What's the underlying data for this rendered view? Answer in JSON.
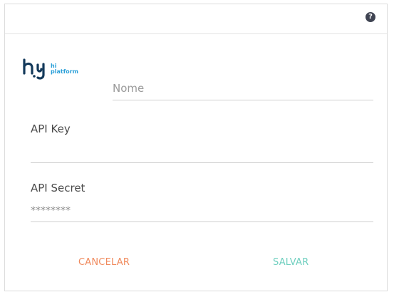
{
  "header": {
    "help_icon": "question-circle-icon",
    "help_glyph": "?"
  },
  "logo": {
    "text_hi": "hi",
    "text_platform": "platform",
    "colors": {
      "mark": "#13395a",
      "accent": "#2a9fd8"
    }
  },
  "form": {
    "name": {
      "placeholder": "Nome",
      "value": ""
    },
    "api_key": {
      "label": "API Key",
      "value": ""
    },
    "api_secret": {
      "label": "API Secret",
      "value": "********"
    }
  },
  "actions": {
    "cancel_label": "CANCELAR",
    "save_label": "SALVAR",
    "colors": {
      "cancel": "#f08a5d",
      "save": "#6fcfbf"
    }
  }
}
